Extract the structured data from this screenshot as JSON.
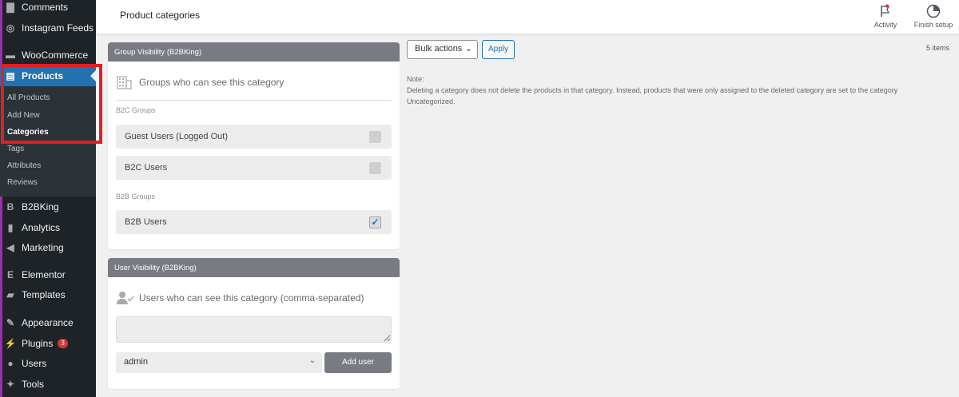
{
  "sidebar": {
    "items": [
      {
        "label": "Comments",
        "icon": "comment-icon"
      },
      {
        "label": "Instagram Feeds",
        "icon": "instagram-icon"
      },
      {
        "label": "WooCommerce",
        "icon": "woocommerce-icon"
      },
      {
        "label": "Products",
        "icon": "archive-icon"
      },
      {
        "label": "B2BKing",
        "icon": "b2bking-icon"
      },
      {
        "label": "Analytics",
        "icon": "bar-chart-icon"
      },
      {
        "label": "Marketing",
        "icon": "megaphone-icon"
      },
      {
        "label": "Elementor",
        "icon": "elementor-icon"
      },
      {
        "label": "Templates",
        "icon": "folder-icon"
      },
      {
        "label": "Appearance",
        "icon": "brush-icon"
      },
      {
        "label": "Plugins",
        "icon": "plug-icon",
        "badge": "3"
      },
      {
        "label": "Users",
        "icon": "user-icon"
      },
      {
        "label": "Tools",
        "icon": "wrench-icon"
      }
    ],
    "submenu": [
      "All Products",
      "Add New",
      "Categories",
      "Tags",
      "Attributes",
      "Reviews"
    ],
    "current_submenu": "Categories"
  },
  "header": {
    "title": "Product categories",
    "actions": [
      {
        "label": "Activity",
        "icon": "flag-icon"
      },
      {
        "label": "Finish setup",
        "icon": "progress-icon"
      }
    ]
  },
  "group_panel": {
    "title": "Group Visibility (B2BKing)",
    "subtitle": "Groups who can see this category",
    "b2c_label": "B2C Groups",
    "b2c_groups": [
      {
        "label": "Guest Users (Logged Out)",
        "checked": false
      },
      {
        "label": "B2C Users",
        "checked": false
      }
    ],
    "b2b_label": "B2B Groups",
    "b2b_groups": [
      {
        "label": "B2B Users",
        "checked": true
      }
    ]
  },
  "user_panel": {
    "title": "User Visibility (B2BKing)",
    "subtitle": "Users who can see this category (comma-separated)",
    "textarea_value": "",
    "select_value": "admin",
    "add_button": "Add user"
  },
  "list": {
    "bulk_actions": "Bulk actions",
    "apply": "Apply",
    "count": "5 items",
    "note_title": "Note:",
    "note_line1": "Deleting a category does not delete the products in that category. Instead, products that were only assigned to the deleted category are set to the category",
    "note_line2": "Uncategorized."
  },
  "colors": {
    "sidebar_bg": "#1d2327",
    "active_blue": "#2271b1",
    "panel_header": "#787c82",
    "highlight_red": "#e31e24",
    "badge_red": "#d63638"
  }
}
